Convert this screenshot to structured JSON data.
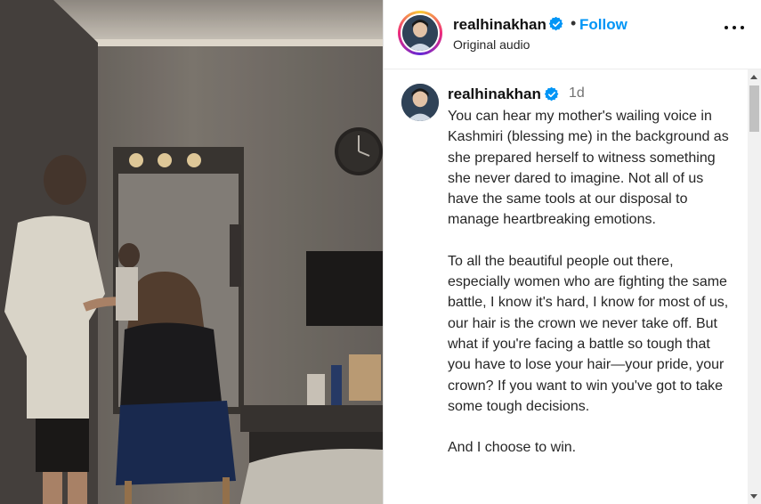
{
  "post": {
    "username": "realhinakhan",
    "follow_label": "Follow",
    "separator": "•",
    "audio": "Original audio"
  },
  "comment": {
    "username": "realhinakhan",
    "time": "1d",
    "paragraphs": [
      "You can hear my mother's wailing voice in Kashmiri (blessing me) in the background as she prepared herself to witness something she never dared to imagine. Not all of us have the same tools at our disposal to manage heartbreaking emotions.",
      "To all the beautiful people out there, especially women who are fighting the same battle, I know it's hard, I know for most of us, our hair is the crown we never take off. But what if you're facing a battle so tough that you have to lose your hair—your pride, your crown? If you want to win you've got to take some tough decisions.",
      "And I choose to win."
    ]
  },
  "icons": {
    "verified": "verified-badge-icon",
    "more": "more-options-icon"
  },
  "colors": {
    "follow": "#0095f6",
    "verified": "#0095f6",
    "text": "#262626",
    "muted": "#737373"
  }
}
